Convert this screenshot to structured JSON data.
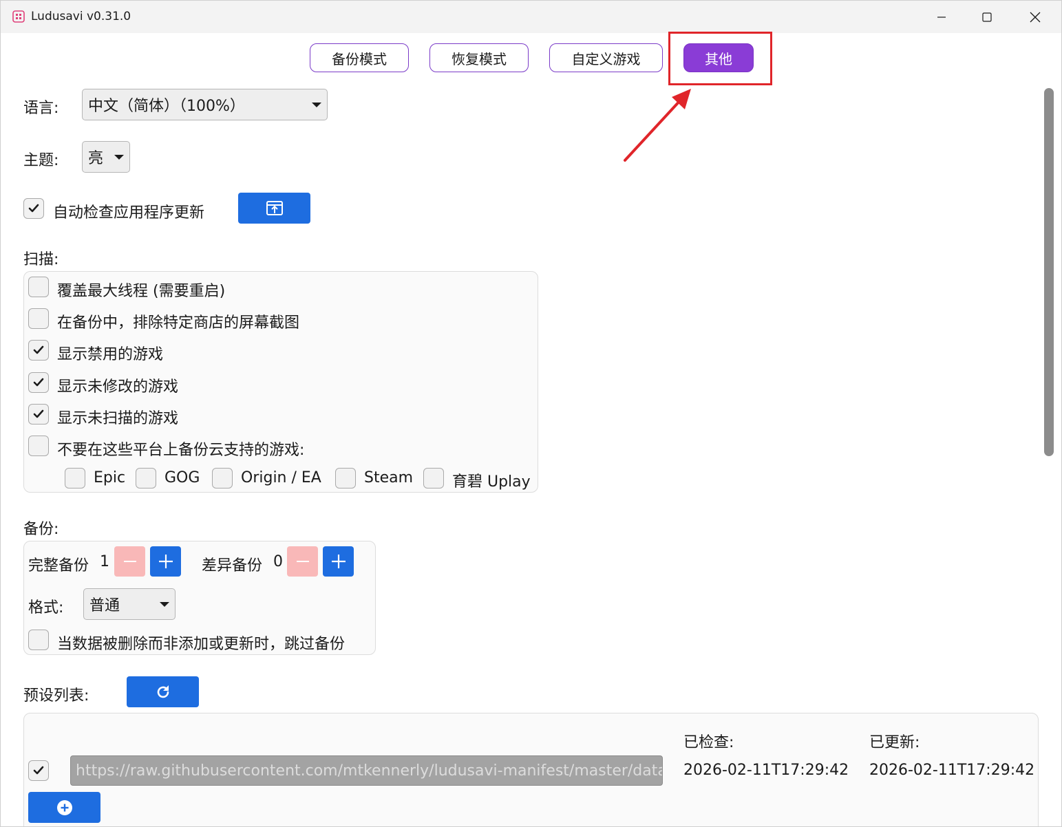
{
  "window": {
    "title": "Ludusavi v0.31.0"
  },
  "nav": {
    "backup": "备份模式",
    "restore": "恢复模式",
    "custom": "自定义游戏",
    "other": "其他"
  },
  "settings": {
    "language_label": "语言:",
    "language_value": "中文（简体）（100%）",
    "theme_label": "主题:",
    "theme_value": "亮",
    "auto_update_label": "自动检查应用程序更新"
  },
  "scan": {
    "heading": "扫描:",
    "options": [
      {
        "label": "覆盖最大线程 (需要重启)",
        "checked": false
      },
      {
        "label": "在备份中，排除特定商店的屏幕截图",
        "checked": false
      },
      {
        "label": "显示禁用的游戏",
        "checked": true
      },
      {
        "label": "显示未修改的游戏",
        "checked": true
      },
      {
        "label": "显示未扫描的游戏",
        "checked": true
      },
      {
        "label": "不要在这些平台上备份云支持的游戏:",
        "checked": false
      }
    ],
    "platforms": [
      "Epic",
      "GOG",
      "Origin / EA",
      "Steam",
      "育碧 Uplay"
    ]
  },
  "backup": {
    "heading": "备份:",
    "full_label": "完整备份",
    "full_count": "1",
    "diff_label": "差异备份",
    "diff_count": "0",
    "format_label": "格式:",
    "format_value": "普通",
    "skip_label": "当数据被删除而非添加或更新时，跳过备份"
  },
  "manifest": {
    "heading": "预设列表:",
    "checked_header": "已检查:",
    "updated_header": "已更新:",
    "url": "https://raw.githubusercontent.com/mtkennerly/ludusavi-manifest/master/data/manifest.yaml",
    "checked_time": "2026-02-11T17:29:42",
    "updated_time": "2026-02-11T17:29:42"
  },
  "colors": {
    "accent_purple": "#8a3cd6",
    "primary_blue": "#1e6de0",
    "disabled_pink": "#f9b8b8",
    "annotation_red": "#e0252a"
  }
}
